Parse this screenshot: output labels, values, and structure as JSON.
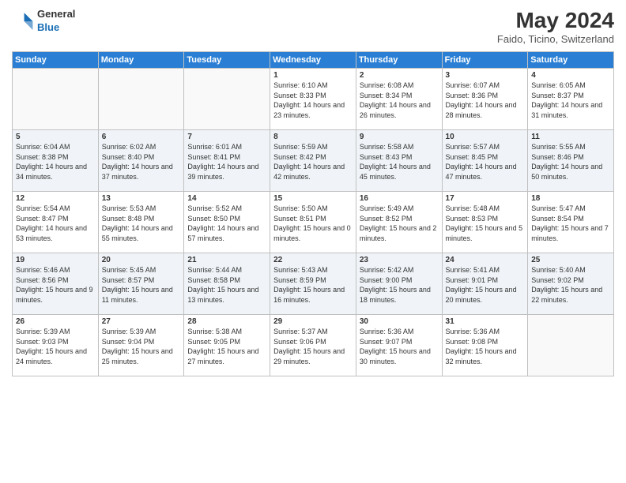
{
  "header": {
    "logo_general": "General",
    "logo_blue": "Blue",
    "month_year": "May 2024",
    "location": "Faido, Ticino, Switzerland"
  },
  "days_of_week": [
    "Sunday",
    "Monday",
    "Tuesday",
    "Wednesday",
    "Thursday",
    "Friday",
    "Saturday"
  ],
  "weeks": [
    [
      {
        "day": "",
        "sunrise": "",
        "sunset": "",
        "daylight": ""
      },
      {
        "day": "",
        "sunrise": "",
        "sunset": "",
        "daylight": ""
      },
      {
        "day": "",
        "sunrise": "",
        "sunset": "",
        "daylight": ""
      },
      {
        "day": "1",
        "sunrise": "6:10 AM",
        "sunset": "8:33 PM",
        "daylight": "14 hours and 23 minutes."
      },
      {
        "day": "2",
        "sunrise": "6:08 AM",
        "sunset": "8:34 PM",
        "daylight": "14 hours and 26 minutes."
      },
      {
        "day": "3",
        "sunrise": "6:07 AM",
        "sunset": "8:36 PM",
        "daylight": "14 hours and 28 minutes."
      },
      {
        "day": "4",
        "sunrise": "6:05 AM",
        "sunset": "8:37 PM",
        "daylight": "14 hours and 31 minutes."
      }
    ],
    [
      {
        "day": "5",
        "sunrise": "6:04 AM",
        "sunset": "8:38 PM",
        "daylight": "14 hours and 34 minutes."
      },
      {
        "day": "6",
        "sunrise": "6:02 AM",
        "sunset": "8:40 PM",
        "daylight": "14 hours and 37 minutes."
      },
      {
        "day": "7",
        "sunrise": "6:01 AM",
        "sunset": "8:41 PM",
        "daylight": "14 hours and 39 minutes."
      },
      {
        "day": "8",
        "sunrise": "5:59 AM",
        "sunset": "8:42 PM",
        "daylight": "14 hours and 42 minutes."
      },
      {
        "day": "9",
        "sunrise": "5:58 AM",
        "sunset": "8:43 PM",
        "daylight": "14 hours and 45 minutes."
      },
      {
        "day": "10",
        "sunrise": "5:57 AM",
        "sunset": "8:45 PM",
        "daylight": "14 hours and 47 minutes."
      },
      {
        "day": "11",
        "sunrise": "5:55 AM",
        "sunset": "8:46 PM",
        "daylight": "14 hours and 50 minutes."
      }
    ],
    [
      {
        "day": "12",
        "sunrise": "5:54 AM",
        "sunset": "8:47 PM",
        "daylight": "14 hours and 53 minutes."
      },
      {
        "day": "13",
        "sunrise": "5:53 AM",
        "sunset": "8:48 PM",
        "daylight": "14 hours and 55 minutes."
      },
      {
        "day": "14",
        "sunrise": "5:52 AM",
        "sunset": "8:50 PM",
        "daylight": "14 hours and 57 minutes."
      },
      {
        "day": "15",
        "sunrise": "5:50 AM",
        "sunset": "8:51 PM",
        "daylight": "15 hours and 0 minutes."
      },
      {
        "day": "16",
        "sunrise": "5:49 AM",
        "sunset": "8:52 PM",
        "daylight": "15 hours and 2 minutes."
      },
      {
        "day": "17",
        "sunrise": "5:48 AM",
        "sunset": "8:53 PM",
        "daylight": "15 hours and 5 minutes."
      },
      {
        "day": "18",
        "sunrise": "5:47 AM",
        "sunset": "8:54 PM",
        "daylight": "15 hours and 7 minutes."
      }
    ],
    [
      {
        "day": "19",
        "sunrise": "5:46 AM",
        "sunset": "8:56 PM",
        "daylight": "15 hours and 9 minutes."
      },
      {
        "day": "20",
        "sunrise": "5:45 AM",
        "sunset": "8:57 PM",
        "daylight": "15 hours and 11 minutes."
      },
      {
        "day": "21",
        "sunrise": "5:44 AM",
        "sunset": "8:58 PM",
        "daylight": "15 hours and 13 minutes."
      },
      {
        "day": "22",
        "sunrise": "5:43 AM",
        "sunset": "8:59 PM",
        "daylight": "15 hours and 16 minutes."
      },
      {
        "day": "23",
        "sunrise": "5:42 AM",
        "sunset": "9:00 PM",
        "daylight": "15 hours and 18 minutes."
      },
      {
        "day": "24",
        "sunrise": "5:41 AM",
        "sunset": "9:01 PM",
        "daylight": "15 hours and 20 minutes."
      },
      {
        "day": "25",
        "sunrise": "5:40 AM",
        "sunset": "9:02 PM",
        "daylight": "15 hours and 22 minutes."
      }
    ],
    [
      {
        "day": "26",
        "sunrise": "5:39 AM",
        "sunset": "9:03 PM",
        "daylight": "15 hours and 24 minutes."
      },
      {
        "day": "27",
        "sunrise": "5:39 AM",
        "sunset": "9:04 PM",
        "daylight": "15 hours and 25 minutes."
      },
      {
        "day": "28",
        "sunrise": "5:38 AM",
        "sunset": "9:05 PM",
        "daylight": "15 hours and 27 minutes."
      },
      {
        "day": "29",
        "sunrise": "5:37 AM",
        "sunset": "9:06 PM",
        "daylight": "15 hours and 29 minutes."
      },
      {
        "day": "30",
        "sunrise": "5:36 AM",
        "sunset": "9:07 PM",
        "daylight": "15 hours and 30 minutes."
      },
      {
        "day": "31",
        "sunrise": "5:36 AM",
        "sunset": "9:08 PM",
        "daylight": "15 hours and 32 minutes."
      },
      {
        "day": "",
        "sunrise": "",
        "sunset": "",
        "daylight": ""
      }
    ]
  ]
}
